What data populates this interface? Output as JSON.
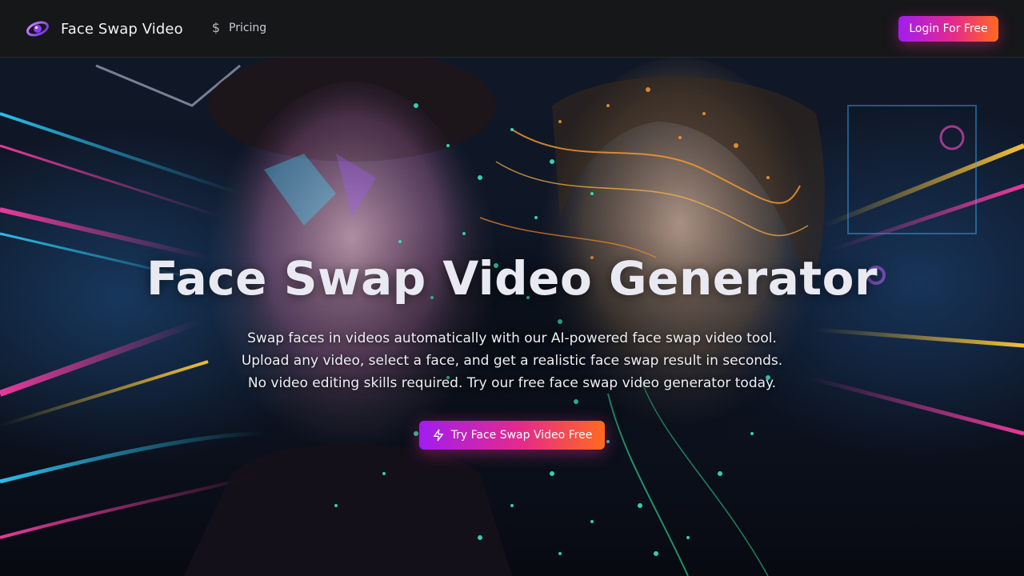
{
  "brand": {
    "name": "Face Swap Video",
    "logo_icon": "swirl-logo-icon"
  },
  "nav": {
    "pricing_label": "Pricing",
    "pricing_icon": "dollar-icon",
    "login_label": "Login For Free"
  },
  "hero": {
    "title": "Face Swap Video Generator",
    "description": [
      "Swap faces in videos automatically with our AI-powered face swap video tool.",
      "Upload any video, select a face, and get a realistic face swap result in seconds.",
      "No video editing skills required. Try our free face swap video generator today."
    ],
    "cta_label": "Try Face Swap Video Free",
    "cta_icon": "lightning-bolt-icon",
    "background": "split portrait of a man and a woman with neon light trails and glowing particles"
  },
  "colors": {
    "accent_start": "#a11df0",
    "accent_mid": "#e52a8a",
    "accent_end": "#ff6a1f",
    "navbar_bg": "#161719"
  }
}
